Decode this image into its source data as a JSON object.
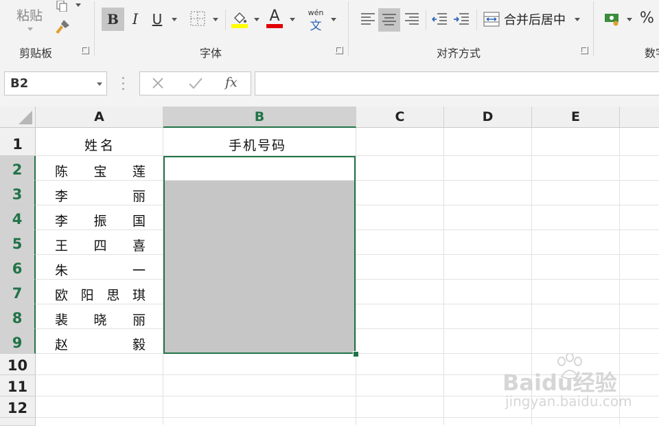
{
  "ribbon": {
    "clipboard": {
      "paste_label": "粘贴",
      "group_label": "剪贴板"
    },
    "font": {
      "group_label": "字体",
      "bold_label": "B",
      "italic_label": "I",
      "underline_label": "U",
      "font_color_label": "A",
      "phonetic_top": "wén",
      "phonetic_bottom": "文",
      "fill_color": "#FFFF00",
      "font_color": "#E00000"
    },
    "alignment": {
      "group_label": "对齐方式",
      "merge_center_label": "合并后居中"
    },
    "number": {
      "group_label": "数字",
      "percent_label": "%"
    }
  },
  "formula_bar": {
    "name_box": "B2",
    "cancel_icon": "cross-icon",
    "enter_icon": "check-icon",
    "fx_label": "fx",
    "formula": ""
  },
  "columns": [
    "A",
    "B",
    "C",
    "D",
    "E"
  ],
  "rows": [
    "1",
    "2",
    "3",
    "4",
    "5",
    "6",
    "7",
    "8",
    "9",
    "10",
    "11",
    "12"
  ],
  "selected_column": "B",
  "selected_range": "B2:B9",
  "cells": {
    "A1": "姓名",
    "B1": "手机号码",
    "names": [
      [
        "陈",
        "宝",
        "莲"
      ],
      [
        "李",
        "",
        "丽"
      ],
      [
        "李",
        "振",
        "国"
      ],
      [
        "王",
        "四",
        "喜"
      ],
      [
        "朱",
        "",
        "一"
      ],
      [
        "欧",
        "阳",
        "思",
        "琪"
      ],
      [
        "裴",
        "晓",
        "丽"
      ],
      [
        "赵",
        "",
        "毅"
      ]
    ]
  },
  "watermark": {
    "brand": "Baidu经验",
    "url": "jingyan.baidu.com"
  },
  "colors": {
    "accent": "#217346",
    "selection_fill": "#C6C6C6"
  }
}
